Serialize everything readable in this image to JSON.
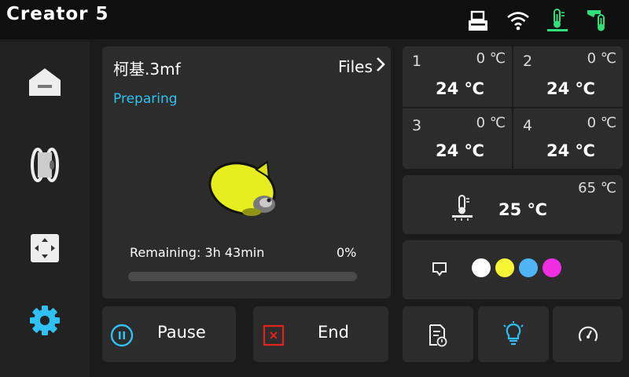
{
  "app": {
    "title": "Creator 5"
  },
  "status_icons": [
    "usb-icon",
    "wifi-icon",
    "heated-bed-icon",
    "nozzle-temp-icon"
  ],
  "sidebar": {
    "items": [
      {
        "name": "home",
        "icon": "home-icon"
      },
      {
        "name": "filament",
        "icon": "filament-spool-icon"
      },
      {
        "name": "move",
        "icon": "move-axis-icon"
      },
      {
        "name": "settings",
        "icon": "gear-icon"
      }
    ]
  },
  "job": {
    "filename": "柯基.3mf",
    "files_label": "Files",
    "status": "Preparing",
    "remaining_label": "Remaining: 3h 43min",
    "progress_label": "0%",
    "progress": 0
  },
  "controls": {
    "pause_label": "Pause",
    "end_label": "End"
  },
  "nozzles": [
    {
      "index": "1",
      "target": "0 ℃",
      "current": "24 ℃"
    },
    {
      "index": "2",
      "target": "0 ℃",
      "current": "24 ℃"
    },
    {
      "index": "3",
      "target": "0 ℃",
      "current": "24 ℃"
    },
    {
      "index": "4",
      "target": "0 ℃",
      "current": "24 ℃"
    }
  ],
  "bed": {
    "target": "65 ℃",
    "current": "25 ℃"
  },
  "filament_colors": [
    "#ffffff",
    "#f7f536",
    "#4fb3f4",
    "#ee2ee0"
  ],
  "colors": {
    "accent": "#2fc1f2",
    "end": "#e2231a",
    "bed_icon": "#2fe07a"
  },
  "toolbar": [
    "file-info-icon",
    "light-bulb-icon",
    "speed-gauge-icon"
  ]
}
